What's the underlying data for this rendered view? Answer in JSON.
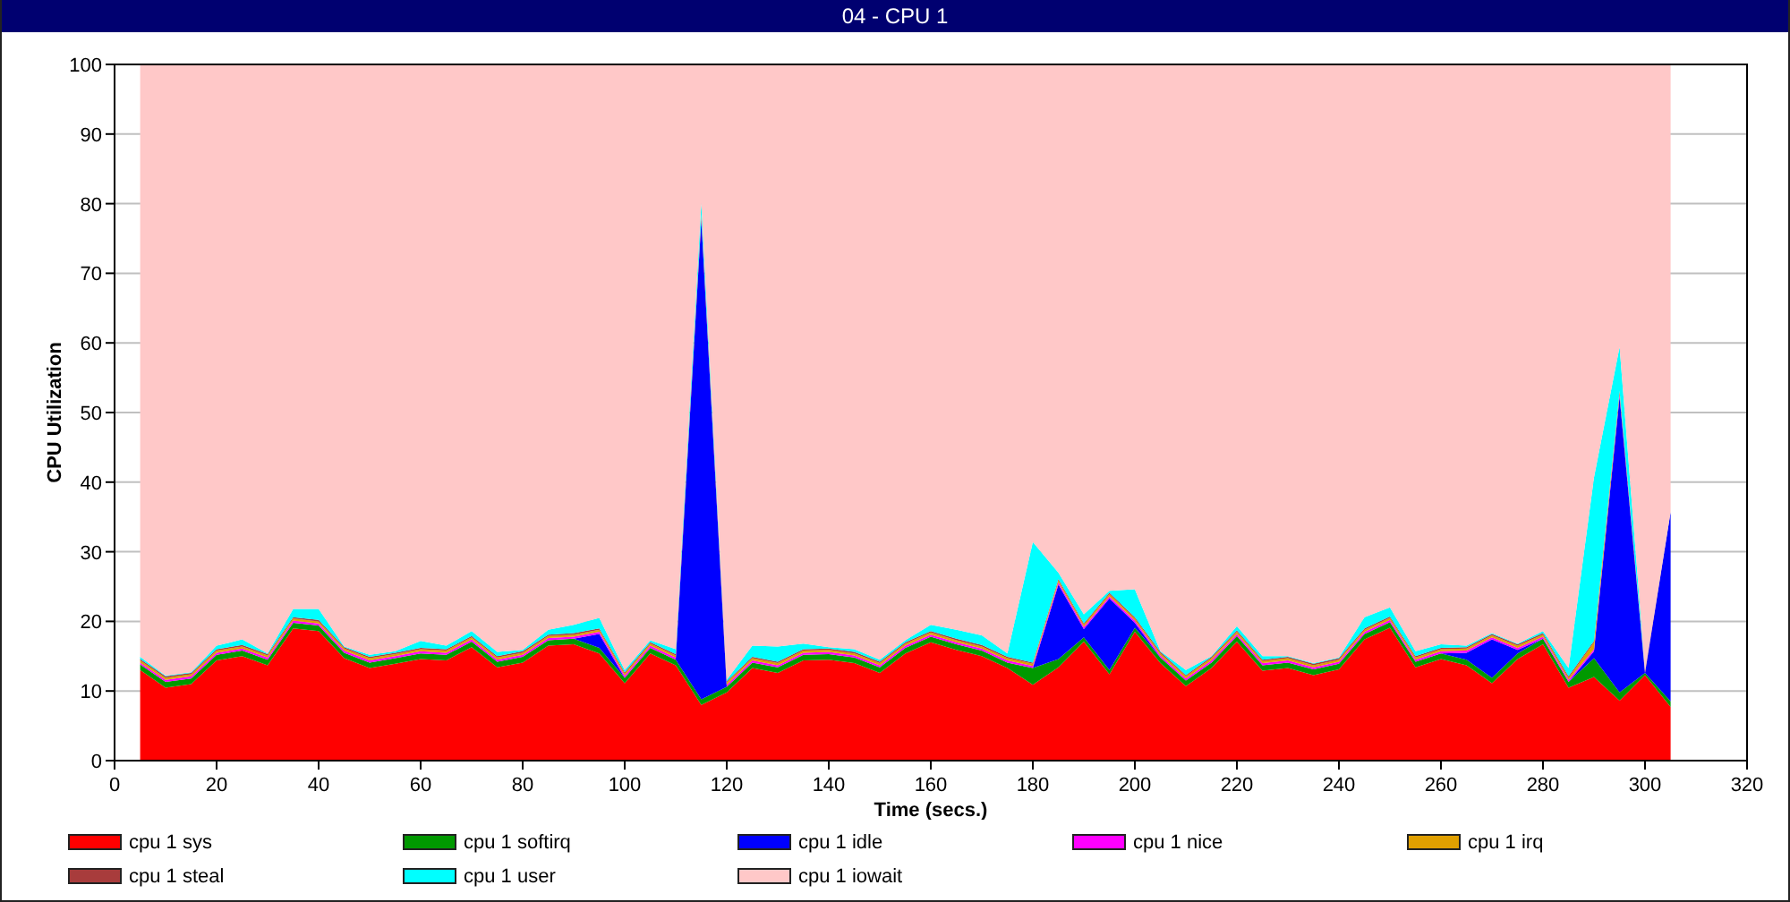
{
  "window": {
    "title": "04 - CPU 1"
  },
  "chart_data": {
    "type": "area",
    "stacked": true,
    "grid": true,
    "xlabel": "Time (secs.)",
    "ylabel": "CPU Utilization",
    "xlim": [
      0,
      320
    ],
    "ylim": [
      0,
      100
    ],
    "xticks": [
      0,
      20,
      40,
      60,
      80,
      100,
      120,
      140,
      160,
      180,
      200,
      220,
      240,
      260,
      280,
      300,
      320
    ],
    "yticks": [
      0,
      10,
      20,
      30,
      40,
      50,
      60,
      70,
      80,
      90,
      100
    ],
    "x": [
      5,
      10,
      15,
      20,
      25,
      30,
      35,
      40,
      45,
      50,
      55,
      60,
      65,
      70,
      75,
      80,
      85,
      90,
      95,
      100,
      105,
      110,
      115,
      120,
      125,
      130,
      135,
      140,
      145,
      150,
      155,
      160,
      165,
      170,
      175,
      180,
      185,
      190,
      195,
      200,
      205,
      210,
      215,
      220,
      225,
      230,
      235,
      240,
      245,
      250,
      255,
      260,
      265,
      270,
      275,
      280,
      285,
      290,
      295,
      300,
      305
    ],
    "series": [
      {
        "name": "cpu 1 sys",
        "color": "#ff0000",
        "values": [
          13,
          10.5,
          11,
          14.4,
          15,
          13.7,
          19,
          18.6,
          14.7,
          13.3,
          13.9,
          14.6,
          14.4,
          16.3,
          13.4,
          14.1,
          16.5,
          16.7,
          15.4,
          11.1,
          15.4,
          13.7,
          8,
          9.8,
          13.3,
          12.6,
          14.4,
          14.5,
          14,
          12.6,
          15.4,
          17,
          15.9,
          15,
          13.3,
          10.9,
          13.4,
          17.1,
          12.4,
          18.5,
          14,
          10.7,
          13.3,
          17.1,
          12.9,
          13.3,
          12.3,
          13.1,
          17.4,
          19.1,
          13.4,
          14.6,
          13.7,
          11.1,
          14.6,
          16.7,
          10.5,
          12,
          8.6,
          12.3,
          7.7
        ]
      },
      {
        "name": "cpu 1 softirq",
        "color": "#009900",
        "values": [
          0.8,
          0.8,
          0.8,
          0.8,
          0.8,
          0.8,
          0.8,
          0.8,
          0.8,
          0.8,
          0.8,
          0.8,
          0.8,
          0.8,
          0.8,
          0.8,
          0.8,
          0.8,
          0.8,
          0.8,
          0.8,
          0.8,
          0.8,
          0.8,
          0.8,
          0.8,
          0.8,
          0.8,
          0.8,
          0.8,
          0.8,
          0.8,
          0.8,
          0.8,
          0.8,
          2.4,
          1.2,
          0.6,
          0.6,
          0.6,
          0.8,
          0.8,
          0.8,
          0.8,
          0.8,
          0.8,
          0.8,
          0.8,
          0.8,
          0.8,
          0.8,
          0.8,
          0.8,
          0.8,
          0.8,
          0.8,
          0.8,
          2.7,
          1.2,
          0.3,
          0.8
        ]
      },
      {
        "name": "cpu 1 idle",
        "color": "#0000ff",
        "values": [
          0,
          0,
          0,
          0,
          0,
          0,
          0,
          0,
          0,
          0,
          0,
          0,
          0,
          0,
          0,
          0,
          0,
          0,
          2,
          0,
          0,
          0,
          68.8,
          0,
          0,
          0,
          0,
          0,
          0,
          0,
          0,
          0,
          0,
          0,
          0,
          0,
          10.7,
          1.2,
          10.3,
          0.7,
          0,
          0,
          0,
          0,
          0,
          0,
          0,
          0,
          0,
          0,
          0,
          0,
          1,
          5.5,
          0.5,
          0,
          0,
          1,
          42.5,
          0,
          27.2
        ]
      },
      {
        "name": "cpu 1 nice",
        "color": "#ff00ff",
        "values": [
          0.3,
          0.3,
          0.3,
          0.3,
          0.3,
          0.3,
          0.3,
          0.3,
          0.3,
          0.3,
          0.3,
          0.3,
          0.3,
          0.3,
          0.3,
          0.3,
          0.3,
          0.3,
          0.3,
          0.3,
          0.3,
          0.3,
          0.3,
          0.3,
          0.3,
          0.3,
          0.3,
          0.3,
          0.3,
          0.3,
          0.3,
          0.3,
          0.3,
          0.3,
          0.3,
          0.3,
          0.3,
          0.3,
          0.3,
          0.3,
          0.3,
          0.3,
          0.3,
          0.3,
          0.3,
          0.3,
          0.3,
          0.3,
          0.3,
          0.3,
          0.3,
          0.3,
          0.3,
          0.3,
          0.3,
          0.3,
          0.3,
          0.3,
          0.3,
          0.1,
          0
        ]
      },
      {
        "name": "cpu 1 irq",
        "color": "#e0a000",
        "values": [
          0.3,
          0.3,
          0.3,
          0.3,
          0.3,
          0.3,
          0.3,
          0.3,
          0.3,
          0.3,
          0.3,
          0.3,
          0.3,
          0.3,
          0.3,
          0.3,
          0.3,
          0.3,
          0.3,
          0.3,
          0.3,
          0.3,
          0.3,
          0.3,
          0.3,
          0.3,
          0.3,
          0.3,
          0.3,
          0.3,
          0.3,
          0.3,
          0.3,
          0.3,
          0.3,
          0.3,
          0.3,
          0.3,
          0.3,
          0.3,
          0.3,
          0.3,
          0.3,
          0.3,
          0.3,
          0.3,
          0.3,
          0.3,
          0.3,
          0.3,
          0.3,
          0.3,
          0.3,
          0.3,
          0.3,
          0.3,
          0.3,
          1,
          0.3,
          0.1,
          0
        ]
      },
      {
        "name": "cpu 1 steal",
        "color": "#a83c3c",
        "values": [
          0.2,
          0.2,
          0.2,
          0.2,
          0.2,
          0.2,
          0.2,
          0.2,
          0.2,
          0.2,
          0.2,
          0.2,
          0.2,
          0.2,
          0.2,
          0.2,
          0.2,
          0.2,
          0.2,
          0.2,
          0.2,
          0.2,
          0.2,
          0.2,
          0.2,
          0.2,
          0.2,
          0.2,
          0.2,
          0.2,
          0.2,
          0.2,
          0.2,
          0.2,
          0.2,
          0.2,
          0.2,
          0.2,
          0.2,
          0.2,
          0.2,
          0.2,
          0.2,
          0.2,
          0.2,
          0.2,
          0.2,
          0.2,
          0.2,
          0.2,
          0.2,
          0.2,
          0.2,
          0.2,
          0.2,
          0.2,
          0.2,
          0.2,
          0.2,
          0.1,
          0
        ]
      },
      {
        "name": "cpu 1 user",
        "color": "#00ffff",
        "values": [
          0.3,
          0.1,
          0.1,
          0.5,
          0.8,
          0.1,
          1.2,
          1.6,
          0.1,
          0.3,
          0.2,
          1.0,
          0.5,
          0.7,
          0.6,
          0.2,
          0.7,
          1.2,
          1.5,
          0.3,
          0.3,
          0.7,
          1.7,
          0.2,
          1.6,
          2.2,
          0.8,
          0.2,
          0.4,
          0.3,
          0.3,
          0.9,
          1.3,
          1.4,
          0.5,
          17.3,
          0.9,
          1.3,
          0.3,
          4,
          0.1,
          0.7,
          0.1,
          0.6,
          0.5,
          0.1,
          0.1,
          0.1,
          1.6,
          1.3,
          0.7,
          0.5,
          0.2,
          0.1,
          0.1,
          0.3,
          1.2,
          23.5,
          6.3,
          0,
          0
        ]
      },
      {
        "name": "cpu 1 iowait",
        "color": "#ffc8c8",
        "values": [
          85.1,
          87.8,
          87.3,
          83.5,
          82.6,
          84.6,
          78.2,
          78.2,
          83.6,
          84.8,
          84.3,
          82.8,
          83.5,
          81.4,
          84.4,
          84.1,
          81.2,
          80.5,
          79.5,
          87,
          82.7,
          84,
          19.9,
          88.4,
          83.5,
          83.6,
          83.2,
          83.7,
          84,
          85.5,
          82.7,
          80.5,
          81.2,
          82,
          84.6,
          68.6,
          73,
          79,
          75.6,
          75.4,
          84.3,
          87,
          85,
          80.7,
          85,
          85,
          86,
          85.2,
          79.4,
          78,
          84.3,
          83.3,
          83.5,
          81.7,
          83.2,
          81.4,
          86.7,
          59.3,
          40.6,
          87.1,
          64.3
        ]
      }
    ]
  }
}
